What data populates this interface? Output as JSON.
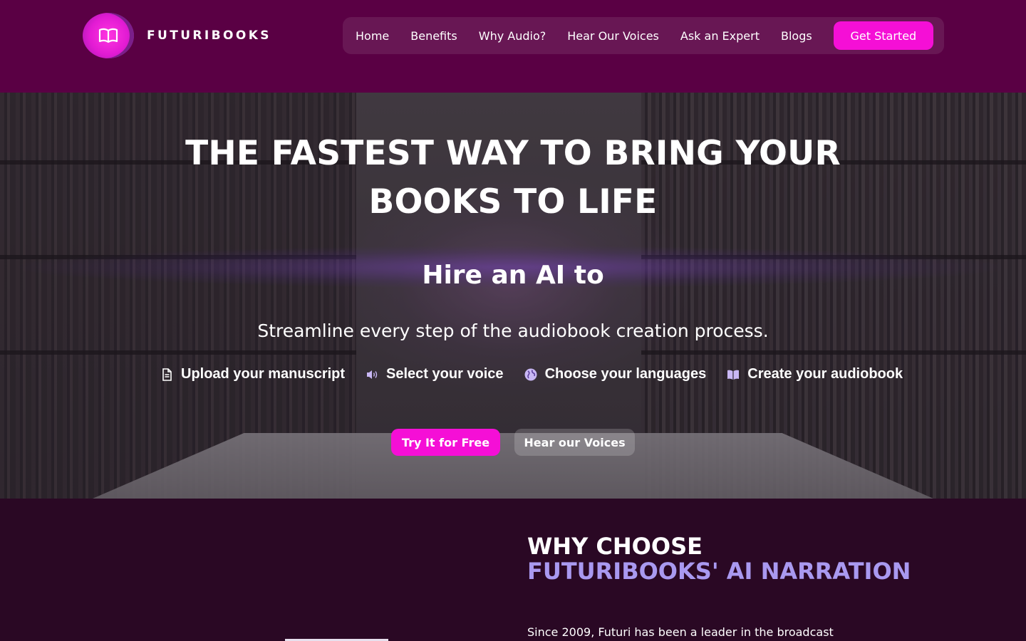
{
  "brand": {
    "name": "FUTURIBOOKS",
    "logo_icon": "open-book-icon",
    "header_bg": "#5a0044",
    "accent": "#f50fd6",
    "section_bg": "#2a0824",
    "highlight": "#a999f0"
  },
  "nav": {
    "items": [
      {
        "label": "Home"
      },
      {
        "label": "Benefits"
      },
      {
        "label": "Why Audio?"
      },
      {
        "label": "Hear Our Voices"
      },
      {
        "label": "Ask an Expert"
      },
      {
        "label": "Blogs"
      }
    ],
    "cta_label": "Get Started"
  },
  "hero": {
    "title": "THE FASTEST WAY TO BRING YOUR BOOKS TO LIFE",
    "subtitle": "Hire an AI to",
    "description": "Streamline every step of the audiobook creation process.",
    "steps": [
      {
        "icon": "document-icon",
        "label": "Upload your manuscript"
      },
      {
        "icon": "speaker-icon",
        "label": "Select your voice"
      },
      {
        "icon": "globe-icon",
        "label": "Choose your languages"
      },
      {
        "icon": "book-icon",
        "label": "Create your audiobook"
      }
    ],
    "primary_button": "Try It for Free",
    "secondary_button": "Hear our Voices"
  },
  "why": {
    "title_line1": "WHY CHOOSE",
    "title_line2": "FUTURIBOOKS' AI NARRATION",
    "text": "Since 2009, Futuri has been a leader in the broadcast"
  }
}
